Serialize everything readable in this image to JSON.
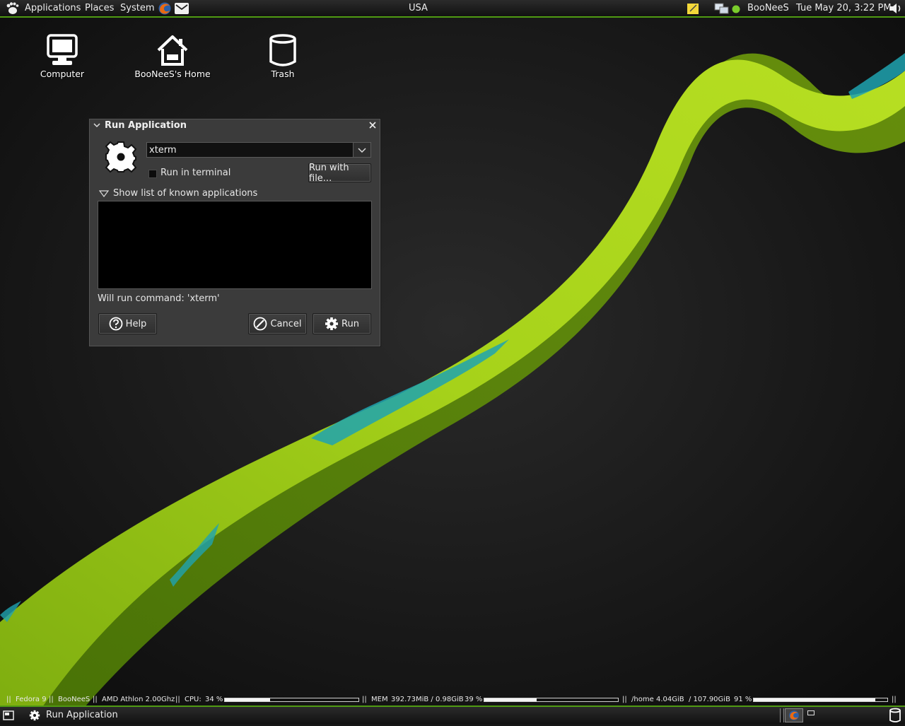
{
  "top_panel": {
    "menus": [
      "Applications",
      "Places",
      "System"
    ],
    "launchers": [
      "firefox-icon",
      "mail-icon"
    ],
    "center_label": "USA",
    "user": "BooNeeS",
    "clock": "Tue May 20,  3:22 PM"
  },
  "desktop": {
    "icons": [
      {
        "label": "Computer",
        "icon": "computer-icon"
      },
      {
        "label": "BooNeeS's Home",
        "icon": "home-icon"
      },
      {
        "label": "Trash",
        "icon": "trash-icon"
      }
    ]
  },
  "dialog": {
    "title": "Run Application",
    "command_value": "xterm",
    "run_in_terminal_label": "Run in terminal",
    "run_in_terminal_checked": false,
    "run_with_file_label": "Run with file...",
    "show_list_label": "Show list of known applications",
    "will_run_text": "Will run command: 'xterm'",
    "help_label": "Help",
    "cancel_label": "Cancel",
    "run_label": "Run"
  },
  "status_bar": {
    "os": "Fedora 9",
    "user": "BooNeeS",
    "cpu_model": "AMD Athlon 2.00Ghz",
    "cpu_label": "CPU:",
    "cpu_value": "34 %",
    "cpu_fraction": 0.34,
    "mem_label": "MEM",
    "mem_value": "392.73MiB / 0.98GiB",
    "mem_percent": "39 %",
    "mem_fraction": 0.39,
    "home_label": "/home",
    "home_value": "4.04GiB",
    "home_total": "/ 107.90GiB",
    "home_percent": "91 %",
    "home_fraction": 0.91,
    "separator": "||"
  },
  "bottom_panel": {
    "task_label": "Run Application"
  },
  "colors": {
    "accent_green": "#4f9a12",
    "wallpaper_ribbon": "#a8d414",
    "wallpaper_cyan": "#1fa3b0"
  }
}
